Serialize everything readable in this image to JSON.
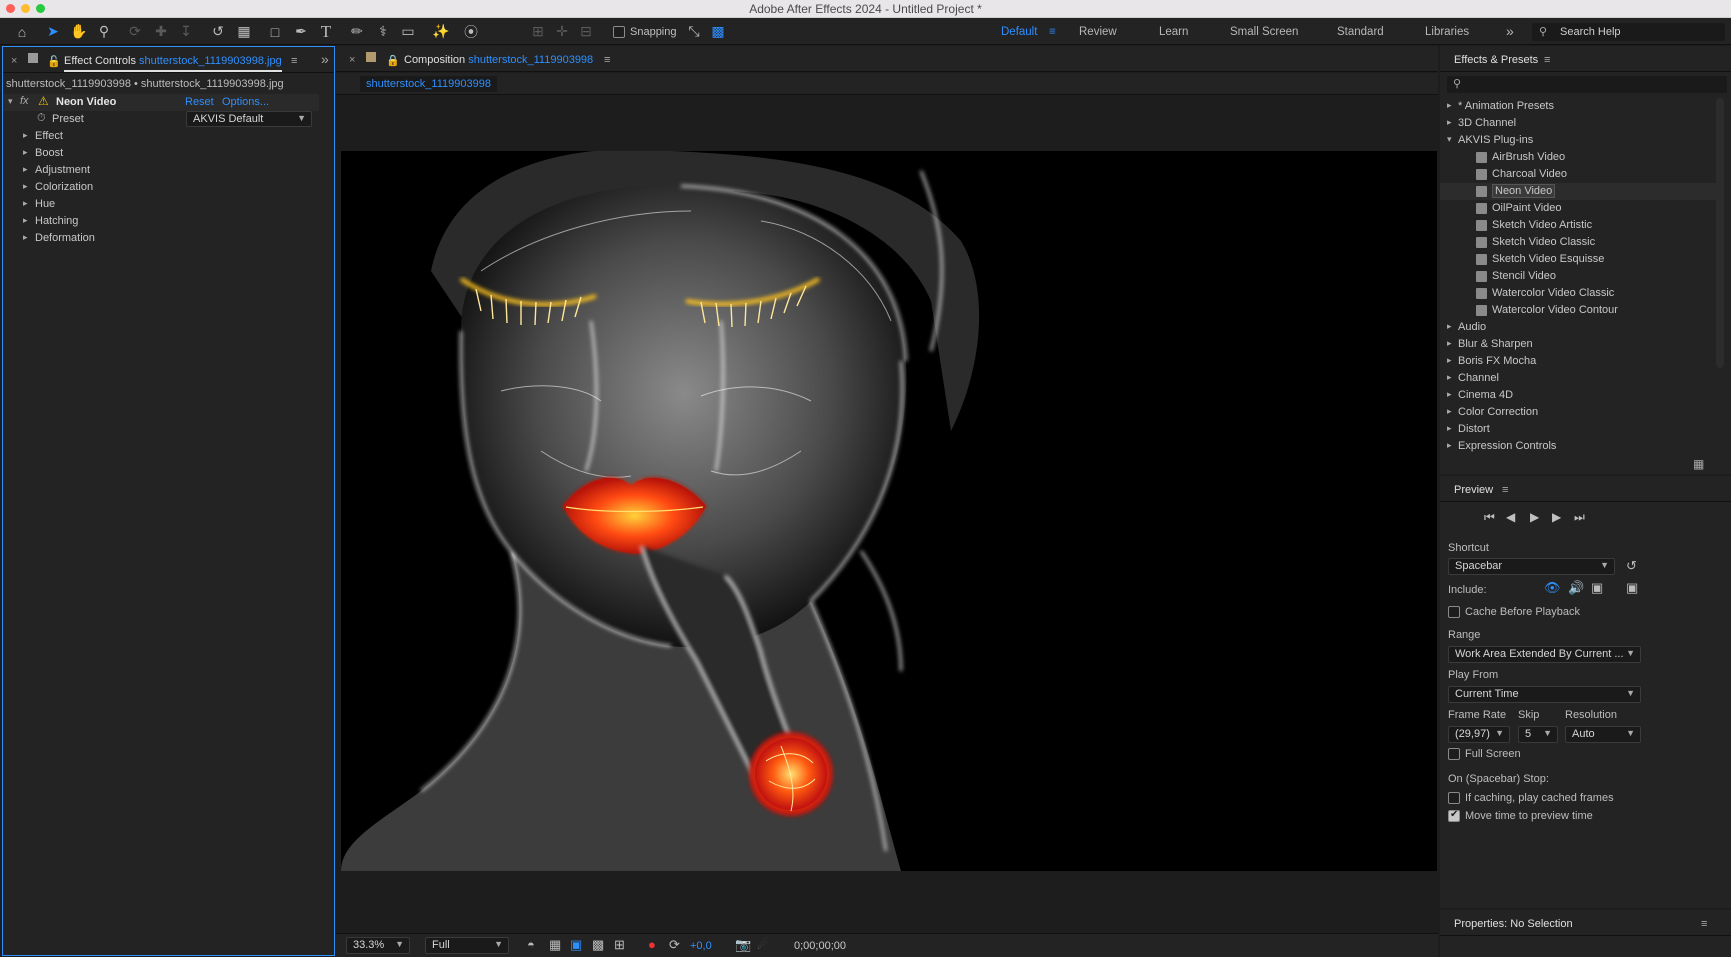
{
  "window": {
    "title": "Adobe After Effects 2024 - Untitled Project *"
  },
  "toolbar": {
    "snapping_label": "Snapping"
  },
  "workspaces": [
    "Default",
    "Review",
    "Learn",
    "Small Screen",
    "Standard",
    "Libraries"
  ],
  "search_help": {
    "placeholder": "Search Help"
  },
  "effect_controls": {
    "tab_label": "Effect Controls",
    "tab_file": "shutterstock_1119903998.jpg",
    "layer_path": "shutterstock_1119903998 • shutterstock_1119903998.jpg",
    "effect_name": "Neon Video",
    "reset_label": "Reset",
    "options_label": "Options...",
    "preset_label": "Preset",
    "preset_value": "AKVIS Default",
    "groups": [
      "Effect",
      "Boost",
      "Adjustment",
      "Colorization",
      "Hue",
      "Hatching",
      "Deformation"
    ]
  },
  "composition": {
    "tab_label": "Composition",
    "tab_name": "shutterstock_1119903998",
    "subtab": "shutterstock_1119903998"
  },
  "viewer_status": {
    "zoom": "33.3%",
    "resolution": "Full",
    "exposure": "+0,0",
    "timecode": "0;00;00;00"
  },
  "effects_presets": {
    "title": "Effects & Presets",
    "search_placeholder": "",
    "categories_top": [
      "* Animation Presets",
      "3D Channel",
      "AKVIS Plug-ins"
    ],
    "akvis_items": [
      "AirBrush Video",
      "Charcoal Video",
      "Neon Video",
      "OilPaint Video",
      "Sketch Video Artistic",
      "Sketch Video Classic",
      "Sketch Video Esquisse",
      "Stencil Video",
      "Watercolor Video Classic",
      "Watercolor Video Contour"
    ],
    "selected_item": "Neon Video",
    "categories_rest": [
      "Audio",
      "Blur & Sharpen",
      "Boris FX Mocha",
      "Channel",
      "Cinema 4D",
      "Color Correction",
      "Distort",
      "Expression Controls"
    ]
  },
  "preview": {
    "title": "Preview",
    "shortcut_label": "Shortcut",
    "shortcut_value": "Spacebar",
    "include_label": "Include:",
    "cache_label": "Cache Before Playback",
    "range_label": "Range",
    "range_value": "Work Area Extended By Current ...",
    "play_from_label": "Play From",
    "play_from_value": "Current Time",
    "frame_rate_label": "Frame Rate",
    "frame_rate_value": "(29,97)",
    "skip_label": "Skip",
    "skip_value": "5",
    "resolution_label": "Resolution",
    "resolution_value": "Auto",
    "full_screen_label": "Full Screen",
    "stop_label": "On (Spacebar) Stop:",
    "if_caching_label": "If caching, play cached frames",
    "move_time_label": "Move time to preview time",
    "cache_checked": false,
    "full_screen_checked": false,
    "if_caching_checked": false,
    "move_time_checked": true
  },
  "properties": {
    "title": "Properties: No Selection"
  },
  "colors": {
    "accent": "#2e8fff",
    "panel": "#232323",
    "background": "#1d1d1d"
  }
}
